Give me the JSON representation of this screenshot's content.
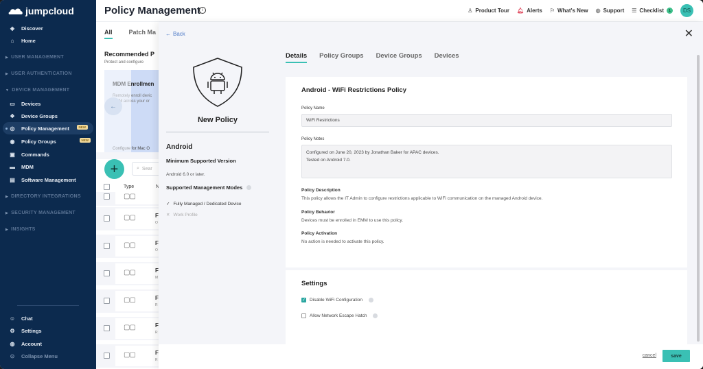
{
  "app": {
    "brand": "jumpcloud"
  },
  "sidebar": {
    "top_items": [
      {
        "label": "Discover",
        "icon": "discover-icon"
      },
      {
        "label": "Home",
        "icon": "home-icon"
      }
    ],
    "sections": {
      "user_management": "USER MANAGEMENT",
      "user_authentication": "USER AUTHENTICATION",
      "device_management": "DEVICE MANAGEMENT",
      "directory_integrations": "DIRECTORY INTEGRATIONS",
      "security_management": "SECURITY MANAGEMENT",
      "insights": "INSIGHTS"
    },
    "device_items": [
      {
        "label": "Devices"
      },
      {
        "label": "Device Groups"
      },
      {
        "label": "Policy Management",
        "badge": "NEW",
        "active": true
      },
      {
        "label": "Policy Groups",
        "badge": "NEW"
      },
      {
        "label": "Commands"
      },
      {
        "label": "MDM"
      },
      {
        "label": "Software Management"
      }
    ],
    "bottom_items": [
      {
        "label": "Chat"
      },
      {
        "label": "Settings"
      },
      {
        "label": "Account"
      },
      {
        "label": "Collapse Menu"
      }
    ]
  },
  "header": {
    "title": "Policy Management",
    "links": {
      "product_tour": "Product Tour",
      "alerts": "Alerts",
      "whats_new": "What's New",
      "support": "Support",
      "checklist": "Checklist",
      "checklist_count": "1"
    },
    "avatar_initials": "DS"
  },
  "background_page": {
    "tabs": {
      "all": "All",
      "patch": "Patch Ma"
    },
    "recommended_title": "Recommended P",
    "recommended_sub": "Protect and configure",
    "card": {
      "title": "MDM Enrollmen",
      "desc_line1": "Remotely enroll devic",
      "desc_line2": "MDM across your or",
      "configure": "Configure for:Mac O"
    },
    "search_placeholder": "Sear",
    "table_headers": {
      "type": "Type",
      "name": "N"
    },
    "rows": [
      {
        "title": "F",
        "sub": "O"
      },
      {
        "title": "F",
        "sub": "O"
      },
      {
        "title": "F",
        "sub": "M"
      },
      {
        "title": "F",
        "sub": "R"
      },
      {
        "title": "F",
        "sub": "R"
      },
      {
        "title": "F",
        "sub": "R"
      }
    ]
  },
  "panel": {
    "back_label": "Back",
    "new_policy_label": "New Policy",
    "os": "Android",
    "min_version_label": "Minimum Supported Version",
    "min_version_value": "Android 6.0 or later.",
    "modes_label": "Supported Management Modes",
    "modes": [
      {
        "label": "Fully Managed / Dedicated Device",
        "supported": true
      },
      {
        "label": "Work Profile",
        "supported": false
      }
    ],
    "tabs": [
      {
        "label": "Details",
        "active": true
      },
      {
        "label": "Policy Groups"
      },
      {
        "label": "Device Groups"
      },
      {
        "label": "Devices"
      }
    ],
    "details": {
      "title": "Android - WiFi Restrictions Policy",
      "policy_name_label": "Policy Name",
      "policy_name_value": "WiFi Restrictions",
      "policy_notes_label": "Policy Notes",
      "policy_notes_value": "Configured on June 20, 2023 by Jonathan Baker for APAC devices.\nTested on Android 7.0.",
      "description_label": "Policy Description",
      "description_value": "This policy allows the IT Admin to configure restrictions applicable to WiFi communication on the managed Android device.",
      "behavior_label": "Policy Behavior",
      "behavior_value": "Devices must be enrolled in EMM to use this policy.",
      "activation_label": "Policy Activation",
      "activation_value": "No action is needed to activate this policy."
    },
    "settings": {
      "title": "Settings",
      "options": [
        {
          "label": "Disable WiFi Configuration",
          "checked": true
        },
        {
          "label": "Allow Network Escape Hatch",
          "checked": false
        }
      ]
    },
    "footer": {
      "cancel": "cancel",
      "save": "save"
    }
  },
  "colors": {
    "accent": "#3ac0b4",
    "sidebar_bg": "#0c2a4e",
    "link": "#4c79c7"
  }
}
